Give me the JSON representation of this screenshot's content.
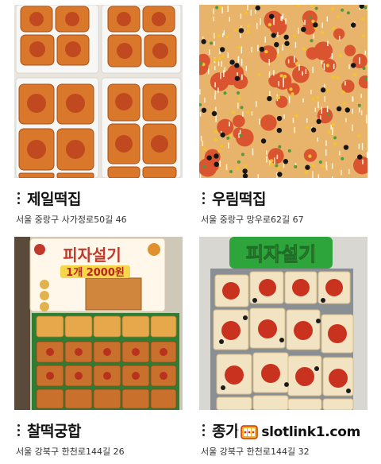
{
  "cards": [
    {
      "name": "제일떡집",
      "address": "서울 중랑구 사가정로50길 46",
      "image": "pizza-rice-cakes-in-trays"
    },
    {
      "name": "우림떡집",
      "address": "서울 중랑구 망우로62길 67",
      "image": "pizza-topping-closeup"
    },
    {
      "name": "찰떡궁합",
      "address": "서울 강북구 한천로144길 26",
      "image": "pizza-rice-cakes-with-sign",
      "sign": {
        "title": "피자설기",
        "price": "1개 2000원"
      }
    },
    {
      "name": "종가",
      "address": "서울 강북구 한천로144길 32",
      "image": "pizza-rice-cakes-pepperoni",
      "sign": {
        "title": "피자설기"
      }
    }
  ],
  "watermark": {
    "text": "slotlink1.com",
    "icon": "slot-logo-icon"
  },
  "colors": {
    "pizza_red": "#c0392b",
    "cheese": "#f3d27a",
    "sign_green": "#2f7d32"
  }
}
